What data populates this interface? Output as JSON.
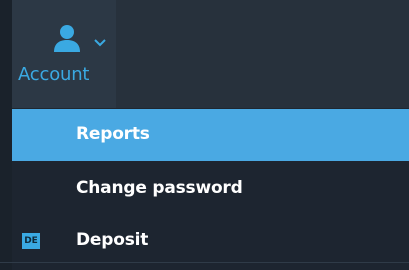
{
  "header": {
    "account_label": "Account"
  },
  "menu": {
    "items": [
      {
        "label": "Reports",
        "active": true
      },
      {
        "label": "Change password",
        "active": false
      },
      {
        "label": "Deposit",
        "active": false,
        "badge": "DE"
      }
    ]
  },
  "icons": {
    "user": "user-icon",
    "chevron": "chevron-down-icon"
  },
  "colors": {
    "accent": "#3aa9e2",
    "active_item": "#4aa9e3",
    "menu_bg": "#1d2530",
    "header_bg": "#27313c"
  }
}
